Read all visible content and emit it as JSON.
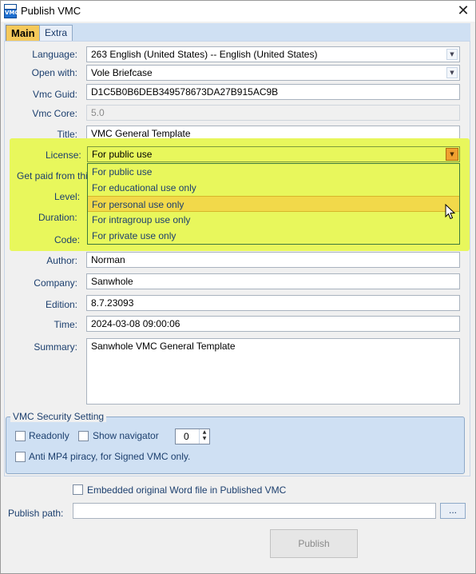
{
  "window": {
    "title": "Publish VMC",
    "icon": "vmc-app-icon",
    "close": "✕"
  },
  "tabs": [
    {
      "label": "Main"
    },
    {
      "label": "Extra"
    }
  ],
  "form": {
    "language": {
      "label": "Language:",
      "value": "263 English (United States) -- English (United States)"
    },
    "open_with": {
      "label": "Open with:",
      "value": "Vole Briefcase"
    },
    "vmc_guid": {
      "label": "Vmc Guid:",
      "value": "D1C5B0B6DEB349578673DA27B915AC9B"
    },
    "vmc_core": {
      "label": "Vmc Core:",
      "value": "5.0"
    },
    "title": {
      "label": "Title:",
      "value": "VMC General Template"
    },
    "license": {
      "label": "License:",
      "value": "For public use",
      "options": [
        "For public use",
        "For educational use only",
        "For personal use only",
        "For intragroup use only",
        "For private use only"
      ],
      "hovered": "For personal use only"
    },
    "get_paid": {
      "label": "Get paid from this"
    },
    "level": {
      "label": "Level:"
    },
    "duration": {
      "label": "Duration:"
    },
    "code": {
      "label": "Code:"
    },
    "author": {
      "label": "Author:",
      "value": "Norman"
    },
    "company": {
      "label": "Company:",
      "value": "Sanwhole"
    },
    "edition": {
      "label": "Edition:",
      "value": "8.7.23093"
    },
    "time": {
      "label": "Time:",
      "value": "2024-03-08 09:00:06"
    },
    "summary": {
      "label": "Summary:",
      "value": "Sanwhole VMC General Template"
    }
  },
  "security": {
    "title": "VMC Security Setting",
    "readonly": {
      "label": "Readonly",
      "checked": false
    },
    "show_navigator": {
      "label": "Show navigator",
      "checked": false
    },
    "navigator_value": "0",
    "anti_piracy": {
      "label": "Anti MP4 piracy, for Signed VMC only.",
      "checked": false
    }
  },
  "footer": {
    "embed_word": {
      "label": "Embedded original Word file in Published VMC",
      "checked": false
    },
    "publish_path": {
      "label": "Publish path:",
      "value": ""
    },
    "browse_label": "...",
    "publish_label": "Publish"
  },
  "colors": {
    "highlight": "#e8f75c",
    "selected_option": "#f2d94a",
    "tab_active": "#f5c95a",
    "label_text": "#1c3f6e"
  }
}
